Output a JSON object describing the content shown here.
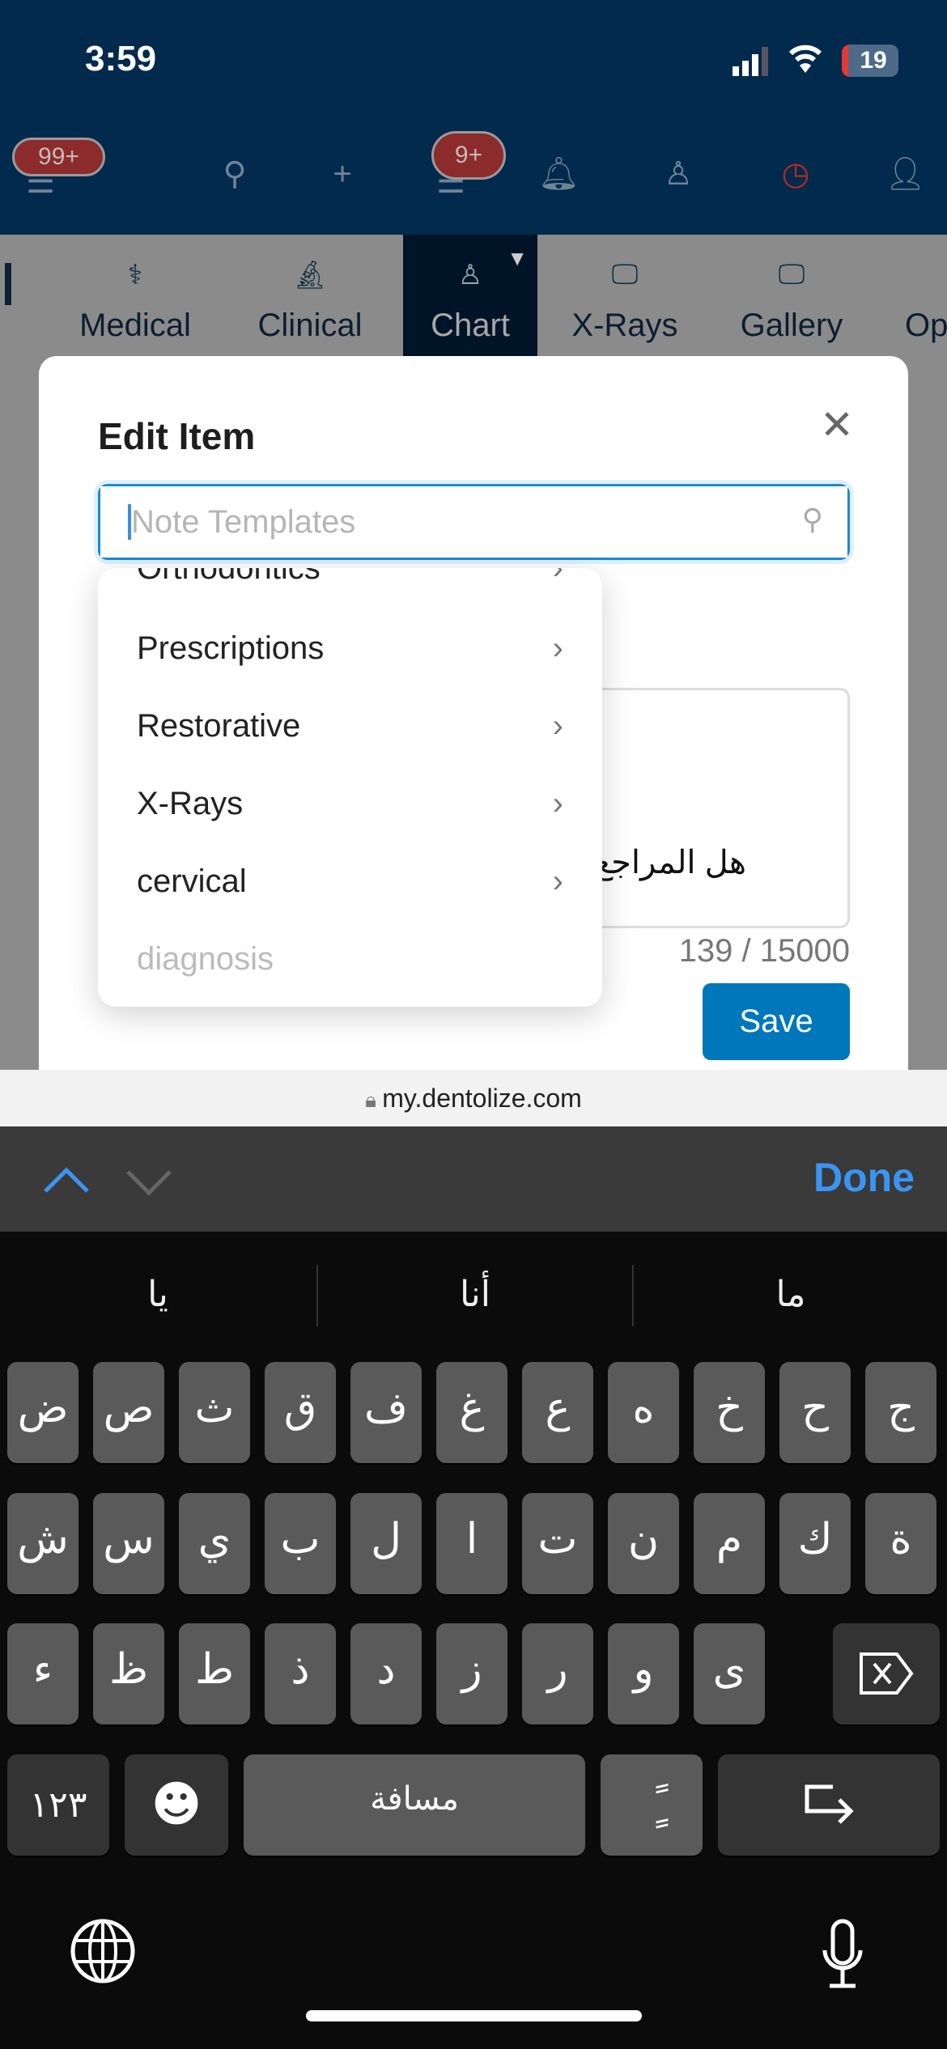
{
  "status_bar": {
    "time": "3:59",
    "battery": "19"
  },
  "header": {
    "menu_badge": "99+",
    "tasks_badge": "9+",
    "icons": [
      "menu-icon",
      "search-icon",
      "plus-icon",
      "task-list-icon",
      "bell-icon",
      "body-chart-icon",
      "clock-icon",
      "user-icon"
    ],
    "accent_clock": "#c62828"
  },
  "tabs": [
    {
      "label": "Medical",
      "icon": "stethoscope-icon"
    },
    {
      "label": "Clinical",
      "icon": "microscope-icon"
    },
    {
      "label": "Chart",
      "icon": "body-chart-icon",
      "active": true
    },
    {
      "label": "X-Rays",
      "icon": "monitor-pulse-icon"
    },
    {
      "label": "Gallery",
      "icon": "gallery-monitor-icon"
    },
    {
      "label": "Op"
    }
  ],
  "modal": {
    "title": "Edit Item",
    "search_placeholder": "Note Templates",
    "note_text": "هل المراجع",
    "counter": "139 / 15000",
    "save_label": "Save"
  },
  "dropdown": {
    "items": [
      {
        "label": "Orthodontics",
        "has_children": true
      },
      {
        "label": "Prescriptions",
        "has_children": true
      },
      {
        "label": "Restorative",
        "has_children": true
      },
      {
        "label": "X-Rays",
        "has_children": true
      },
      {
        "label": "cervical",
        "has_children": true
      },
      {
        "label": "diagnosis",
        "disabled": true
      }
    ]
  },
  "browser": {
    "url": "my.dentolize.com"
  },
  "keyboard": {
    "done_label": "Done",
    "suggestions": [
      "يا",
      "أنا",
      "ما"
    ],
    "row1": [
      "ض",
      "ص",
      "ث",
      "ق",
      "ف",
      "غ",
      "ع",
      "ه",
      "خ",
      "ح",
      "ج"
    ],
    "row2": [
      "ش",
      "س",
      "ي",
      "ب",
      "ل",
      "ا",
      "ت",
      "ن",
      "م",
      "ك",
      "ة"
    ],
    "row3": [
      "ء",
      "ظ",
      "ط",
      "ذ",
      "د",
      "ز",
      "ر",
      "و",
      "ى"
    ],
    "numbers_label": "١٢٣",
    "space_label": "مسافة",
    "diacritic_label": "ًٍ"
  },
  "colors": {
    "primary": "#0077bb",
    "header": "#012a4c",
    "done": "#3a95f2"
  }
}
